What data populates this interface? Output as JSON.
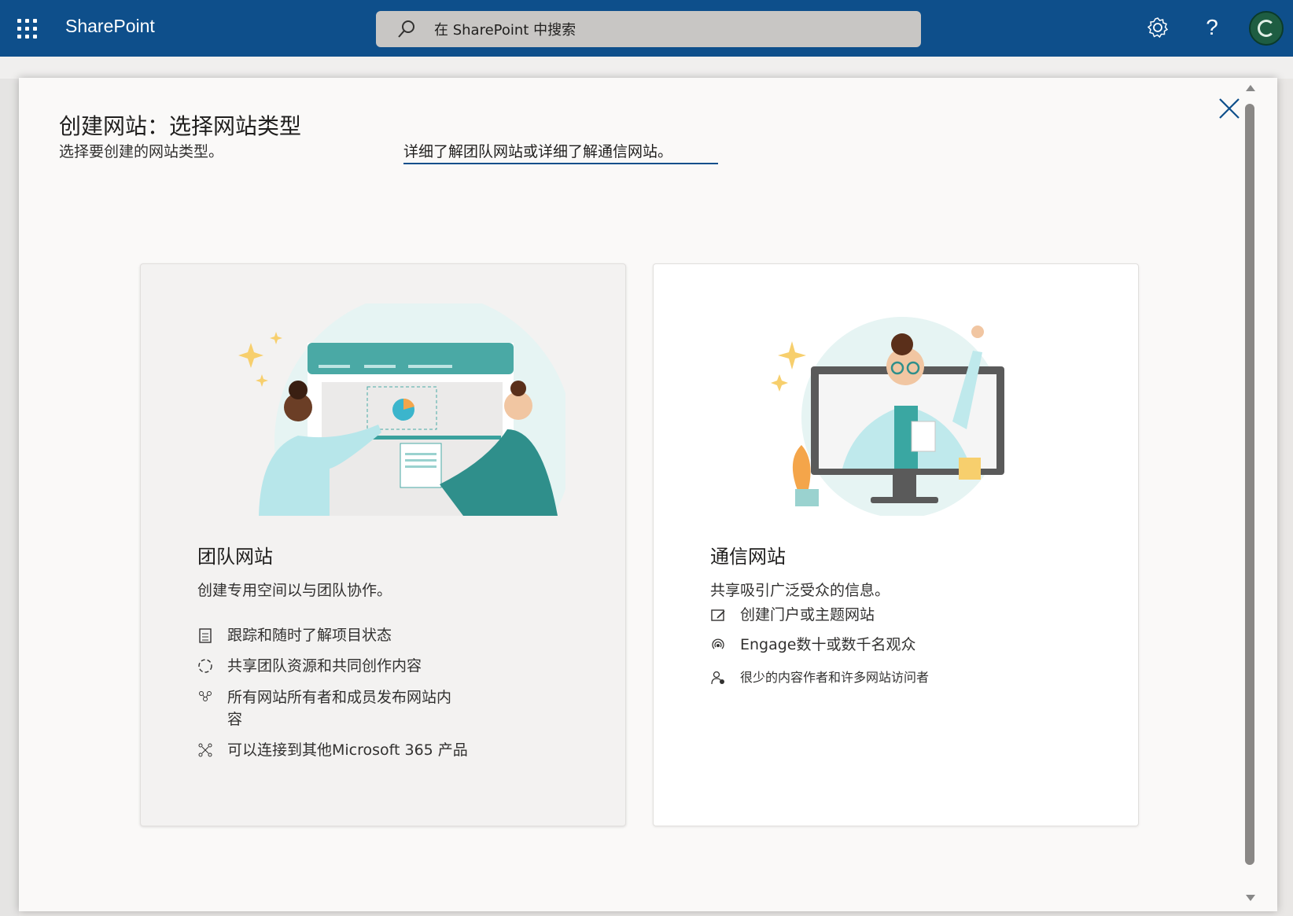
{
  "suitebar": {
    "brand": "SharePoint",
    "search_placeholder": "在 SharePoint 中搜索"
  },
  "dialog": {
    "title": "创建网站：选择网站类型",
    "subtitle": "选择要创建的网站类型。",
    "learn_more": "详细了解团队网站或详细了解通信网站。"
  },
  "team_site": {
    "title": "团队网站",
    "description": "创建专用空间以与团队协作。",
    "features": [
      {
        "icon": "checklist-icon",
        "text": "跟踪和随时了解项目状态"
      },
      {
        "icon": "refresh-circle-icon",
        "text": "共享团队资源和共同创作内容"
      },
      {
        "icon": "people-group-icon",
        "text": "所有网站所有者和成员发布网站内容"
      },
      {
        "icon": "connect-nodes-icon",
        "text": "可以连接到其他Microsoft 365 产品"
      }
    ]
  },
  "comm_site": {
    "title": "通信网站",
    "description": "共享吸引广泛受众的信息。",
    "features": [
      {
        "icon": "edit-page-icon",
        "text": "创建门户或主题网站"
      },
      {
        "icon": "broadcast-icon",
        "text": "Engage数十或数千名观众"
      },
      {
        "icon": "person-presenter-icon",
        "text": "很少的内容作者和许多网站访问者"
      }
    ]
  }
}
